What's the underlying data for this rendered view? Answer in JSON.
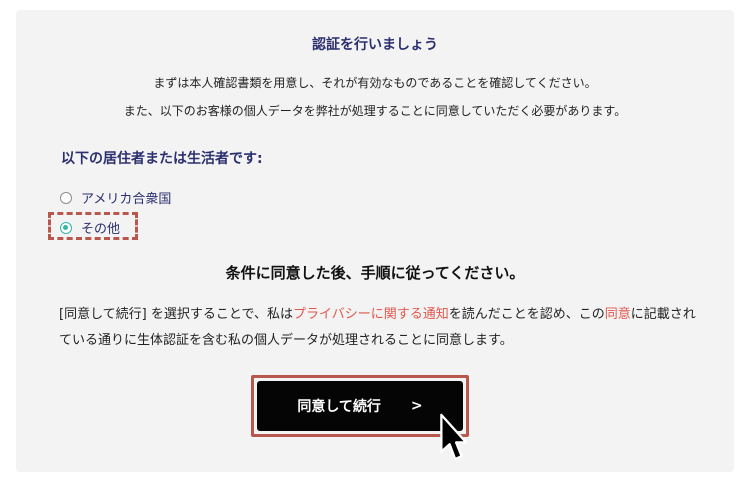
{
  "card": {
    "title": "認証を行いましょう",
    "intro_line1": "まずは本人確認書類を用意し、それが有効なものであることを確認してください。",
    "intro_line2": "また、以下のお客様の個人データを弊社が処理することに同意していただく必要があります。"
  },
  "residence": {
    "heading": "以下の居住者または生活者です:",
    "options": [
      {
        "label": "アメリカ合衆国",
        "selected": false
      },
      {
        "label": "その他",
        "selected": true
      }
    ]
  },
  "steps": {
    "heading": "条件に同意した後、手順に従ってください。"
  },
  "consent": {
    "part1": "[同意して続行] を選択することで、私は",
    "privacy_link": "プライバシーに関する通知",
    "part2": "を読んだことを認め、この",
    "consent_link": "同意",
    "part3": "に記載されている通りに生体認証を含む私の個人データが処理されることに同意します。"
  },
  "cta": {
    "label": "同意して続行",
    "arrow": ">"
  },
  "colors": {
    "heading": "#2b2f6e",
    "link": "#e2574c",
    "radio_selected": "#34b7a6",
    "highlight": "#b9574d",
    "button_bg": "#050505"
  }
}
